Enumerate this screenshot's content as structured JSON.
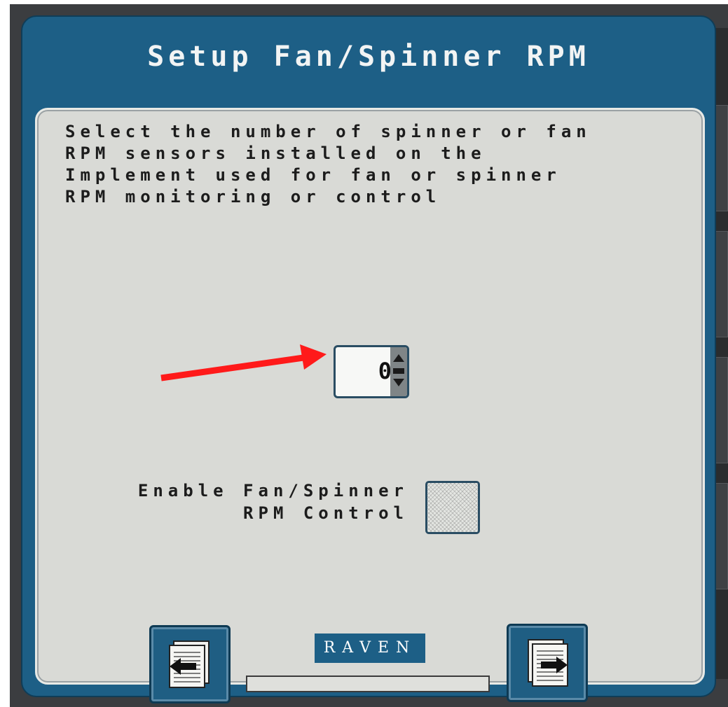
{
  "header": {
    "title": "Setup Fan/Spinner RPM"
  },
  "instructions": "Select the number of spinner or fan\nRPM sensors installed on the\nImplement used for fan or spinner\nRPM monitoring or control",
  "sensor_count": {
    "value": "0"
  },
  "enable_control": {
    "label": "Enable Fan/Spinner\nRPM Control",
    "checked": false
  },
  "brand": {
    "logo_text": "RAVEN"
  },
  "progress": {
    "fraction": 0
  },
  "colors": {
    "screen_blue": "#1d5f86",
    "panel": "#d9dad6",
    "annotation": "#ff1a1a"
  },
  "icons": {
    "prev": "page-back-icon",
    "next": "page-forward-icon"
  }
}
